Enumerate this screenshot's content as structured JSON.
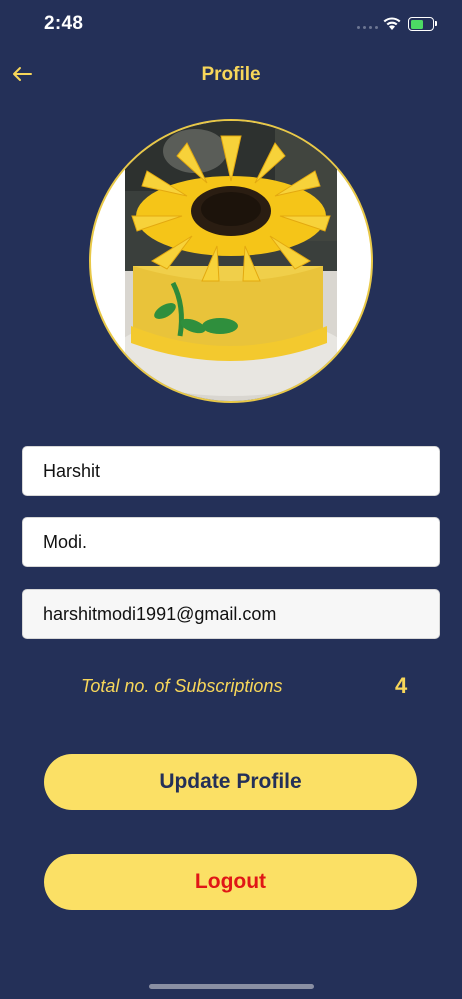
{
  "status_bar": {
    "time": "2:48"
  },
  "header": {
    "title": "Profile",
    "back_icon": "arrow-left-icon"
  },
  "profile": {
    "avatar_description_icon": "sunflower-cake-photo"
  },
  "form": {
    "first_name": "Harshit",
    "last_name": "Modi.",
    "email": "harshitmodi1991@gmail.com"
  },
  "subscriptions": {
    "label": "Total no. of Subscriptions",
    "count": "4"
  },
  "buttons": {
    "update_label": "Update Profile",
    "logout_label": "Logout"
  },
  "colors": {
    "background": "#243058",
    "accent": "#f7d65a",
    "button": "#fbe065",
    "logout_text": "#e01616"
  }
}
